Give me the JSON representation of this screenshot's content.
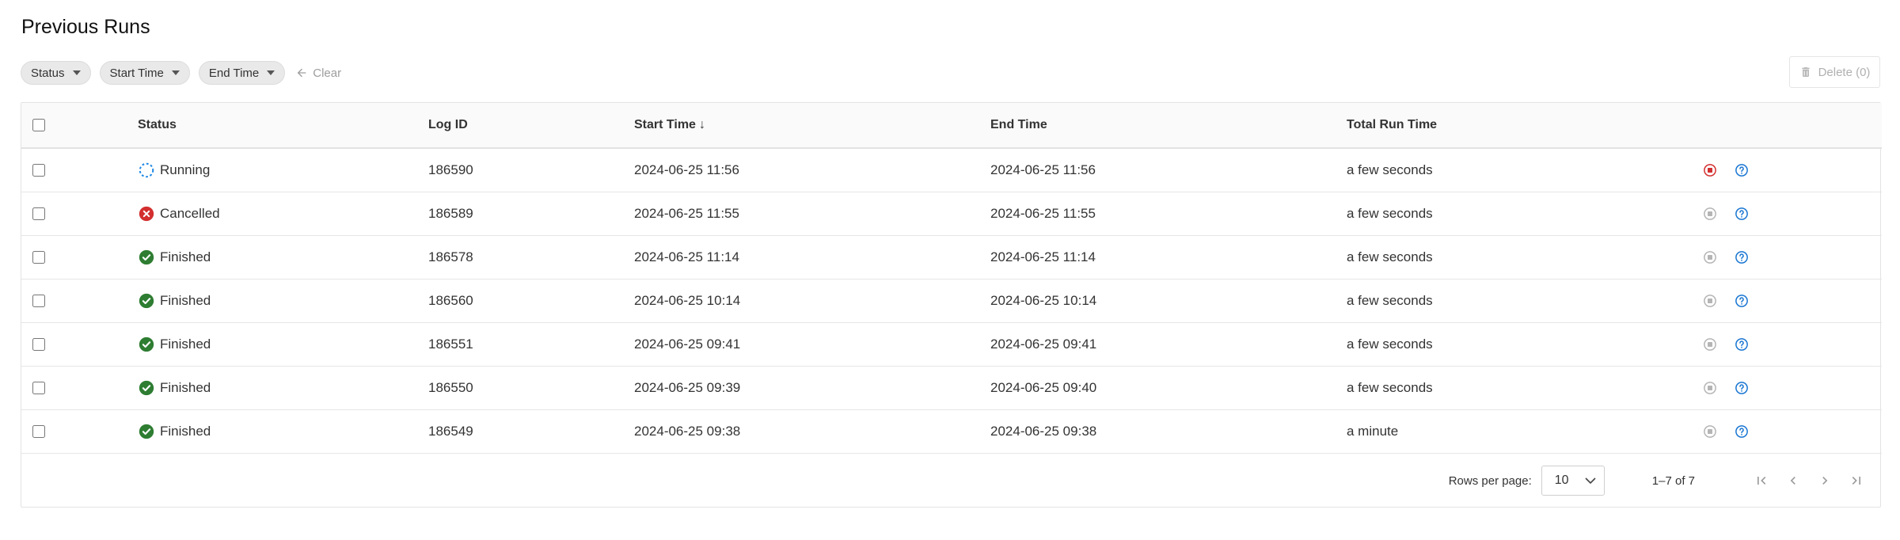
{
  "page": {
    "title": "Previous Runs"
  },
  "filters": {
    "chips": [
      {
        "label": "Status"
      },
      {
        "label": "Start Time"
      },
      {
        "label": "End Time"
      }
    ],
    "clear_label": "Clear"
  },
  "toolbar": {
    "delete_label": "Delete (0)"
  },
  "table": {
    "headers": {
      "status": "Status",
      "log_id": "Log ID",
      "start_time": "Start Time",
      "start_time_sort": "↓",
      "end_time": "End Time",
      "total_run_time": "Total Run Time"
    },
    "rows": [
      {
        "status": "Running",
        "status_icon": "spinner-icon",
        "log_id": "186590",
        "start": "2024-06-25 11:56",
        "end": "2024-06-25 11:56",
        "total": "a few seconds",
        "stop_active": true
      },
      {
        "status": "Cancelled",
        "status_icon": "cancelled-icon",
        "log_id": "186589",
        "start": "2024-06-25 11:55",
        "end": "2024-06-25 11:55",
        "total": "a few seconds",
        "stop_active": false
      },
      {
        "status": "Finished",
        "status_icon": "check-circle-icon",
        "log_id": "186578",
        "start": "2024-06-25 11:14",
        "end": "2024-06-25 11:14",
        "total": "a few seconds",
        "stop_active": false
      },
      {
        "status": "Finished",
        "status_icon": "check-circle-icon",
        "log_id": "186560",
        "start": "2024-06-25 10:14",
        "end": "2024-06-25 10:14",
        "total": "a few seconds",
        "stop_active": false
      },
      {
        "status": "Finished",
        "status_icon": "check-circle-icon",
        "log_id": "186551",
        "start": "2024-06-25 09:41",
        "end": "2024-06-25 09:41",
        "total": "a few seconds",
        "stop_active": false
      },
      {
        "status": "Finished",
        "status_icon": "check-circle-icon",
        "log_id": "186550",
        "start": "2024-06-25 09:39",
        "end": "2024-06-25 09:40",
        "total": "a few seconds",
        "stop_active": false
      },
      {
        "status": "Finished",
        "status_icon": "check-circle-icon",
        "log_id": "186549",
        "start": "2024-06-25 09:38",
        "end": "2024-06-25 09:38",
        "total": "a minute",
        "stop_active": false
      }
    ]
  },
  "pagination": {
    "rows_per_page_label": "Rows per page:",
    "rows_per_page_value": "10",
    "range_label": "1–7 of 7"
  },
  "colors": {
    "running_blue": "#1e88e5",
    "cancelled_red": "#d32f2f",
    "finished_green": "#2e7d32",
    "stop_active_red": "#d32f2f",
    "stop_inactive_gray": "#b5b5b5",
    "help_blue": "#1976d2"
  }
}
